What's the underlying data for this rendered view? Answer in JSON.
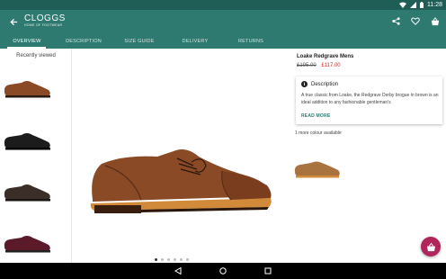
{
  "status_bar": {
    "time": "11:28"
  },
  "app_bar": {
    "logo_main": "CLOGGS",
    "logo_sub": "HOME OF FOOTWEAR",
    "icons": [
      "share-icon",
      "heart-icon",
      "basket-icon"
    ]
  },
  "tabs": [
    {
      "label": "OVERVIEW",
      "active": true
    },
    {
      "label": "DESCRIPTION",
      "active": false
    },
    {
      "label": "SIZE GUIDE",
      "active": false
    },
    {
      "label": "DELIVERY",
      "active": false
    },
    {
      "label": "RETURNS",
      "active": false
    }
  ],
  "recently_viewed": {
    "title": "Recently viewed",
    "items": [
      {
        "color": "#8a4a26"
      },
      {
        "color": "#1c1c1c"
      },
      {
        "color": "#3b2e28"
      },
      {
        "color": "#5a1a2a"
      }
    ]
  },
  "gallery": {
    "dot_count": 6,
    "active_index": 0
  },
  "product": {
    "name": "Loake Redgrave Mens",
    "price_old": "£195.00",
    "price_new": "£117.00",
    "description_title": "Description",
    "description_text": "A true classic from Loake, the Redgrave Derby brogue in brown is an ideal addition to any fashionable gentleman's",
    "read_more": "READ MORE",
    "colours_text": "1 more colour available"
  },
  "colors": {
    "primary": "#2f7a70",
    "status_bar": "#1e5e57",
    "sale_price": "#d32f2f",
    "fab": "#b0265a"
  }
}
